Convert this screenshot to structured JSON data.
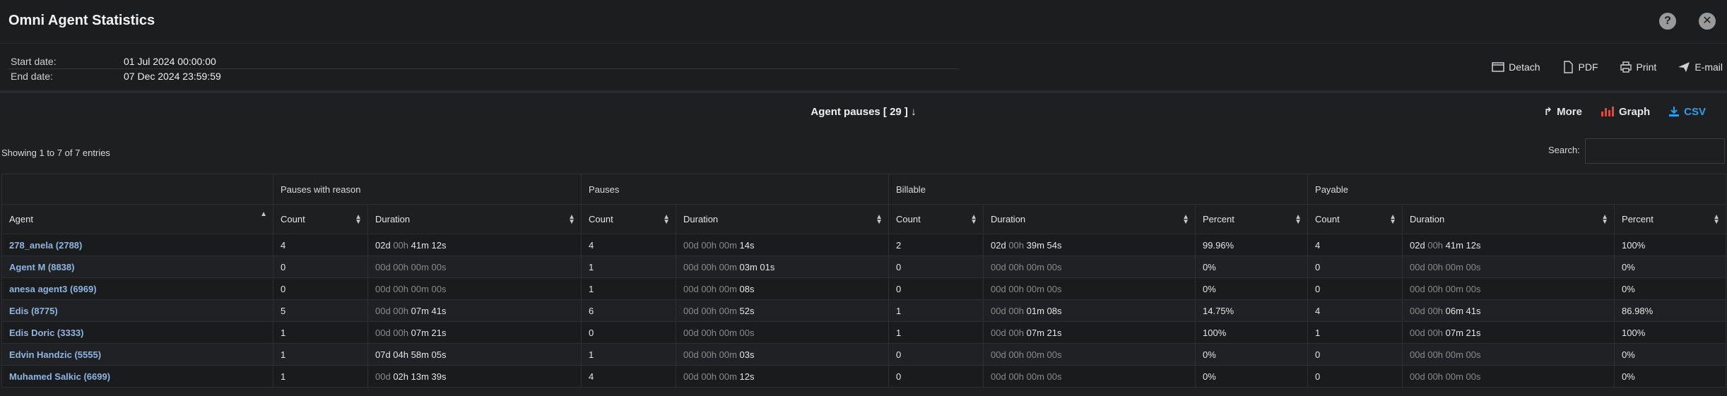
{
  "app": {
    "title": "Omni Agent Statistics",
    "help_icon": "help-icon",
    "close_icon": "close-icon"
  },
  "info": {
    "start_label": "Start date:",
    "start_value": "01 Jul 2024 00:00:00",
    "end_label": "End date:",
    "end_value": "07 Dec 2024 23:59:59"
  },
  "actions": {
    "detach": "Detach",
    "pdf": "PDF",
    "print": "Print",
    "email": "E-mail"
  },
  "report": {
    "title": "Agent pauses [ 29 ]",
    "more": "More",
    "graph": "Graph",
    "csv": "CSV",
    "colors": {
      "graph": "#e8443a",
      "csv": "#2f9de8"
    }
  },
  "table": {
    "showing": "Showing 1 to 7 of 7 entries",
    "search_label": "Search:",
    "search_value": "",
    "groups": [
      "Pauses with reason",
      "Pauses",
      "Billable",
      "Payable"
    ],
    "columns": [
      "Agent",
      "Count",
      "Duration",
      "Count",
      "Duration",
      "Count",
      "Duration",
      "Percent",
      "Count",
      "Duration",
      "Percent"
    ],
    "rows": [
      {
        "agent": "278_anela (2788)",
        "c1": "4",
        "d1": [
          "02d",
          "00h",
          "41m 12s"
        ],
        "c2": "4",
        "d2": [
          "00d 00h 00m",
          "14s"
        ],
        "c3": "2",
        "d3": [
          "02d",
          "00h",
          "39m 54s"
        ],
        "p3": "99.96%",
        "c4": "4",
        "d4": [
          "02d",
          "00h",
          "41m 12s"
        ],
        "p4": "100%"
      },
      {
        "agent": "Agent M (8838)",
        "c1": "0",
        "d1": [
          "00d 00h 00m 00s",
          "",
          ""
        ],
        "c2": "1",
        "d2": [
          "00d 00h 00m",
          "03m 01s"
        ],
        "c3": "0",
        "d3": [
          "00d 00h 00m 00s",
          "",
          ""
        ],
        "p3": "0%",
        "c4": "0",
        "d4": [
          "00d 00h 00m 00s",
          "",
          ""
        ],
        "p4": "0%"
      },
      {
        "agent": "anesa agent3 (6969)",
        "c1": "0",
        "d1": [
          "00d 00h 00m 00s",
          "",
          ""
        ],
        "c2": "1",
        "d2": [
          "00d 00h 00m",
          "08s"
        ],
        "c3": "0",
        "d3": [
          "00d 00h 00m 00s",
          "",
          ""
        ],
        "p3": "0%",
        "c4": "0",
        "d4": [
          "00d 00h 00m 00s",
          "",
          ""
        ],
        "p4": "0%"
      },
      {
        "agent": "Edis (8775)",
        "c1": "5",
        "d1": [
          "00d 00h",
          "",
          "07m 41s"
        ],
        "c2": "6",
        "d2": [
          "00d 00h 00m",
          "52s"
        ],
        "c3": "1",
        "d3": [
          "00d 00h",
          "",
          "01m 08s"
        ],
        "p3": "14.75%",
        "c4": "4",
        "d4": [
          "00d 00h",
          "",
          "06m 41s"
        ],
        "p4": "86.98%"
      },
      {
        "agent": "Edis Doric (3333)",
        "c1": "1",
        "d1": [
          "00d 00h",
          "",
          "07m 21s"
        ],
        "c2": "0",
        "d2": [
          "00d 00h 00m 00s",
          ""
        ],
        "c3": "1",
        "d3": [
          "00d 00h",
          "",
          "07m 21s"
        ],
        "p3": "100%",
        "c4": "1",
        "d4": [
          "00d 00h",
          "",
          "07m 21s"
        ],
        "p4": "100%"
      },
      {
        "agent": "Edvin Handzic (5555)",
        "c1": "1",
        "d1": [
          "",
          "",
          "07d 04h 58m 05s"
        ],
        "c2": "1",
        "d2": [
          "00d 00h 00m",
          "03s"
        ],
        "c3": "0",
        "d3": [
          "00d 00h 00m 00s",
          "",
          ""
        ],
        "p3": "0%",
        "c4": "0",
        "d4": [
          "00d 00h 00m 00s",
          "",
          ""
        ],
        "p4": "0%"
      },
      {
        "agent": "Muhamed Salkic (6699)",
        "c1": "1",
        "d1": [
          "00d",
          "",
          "02h 13m 39s"
        ],
        "c2": "4",
        "d2": [
          "00d 00h 00m",
          "12s"
        ],
        "c3": "0",
        "d3": [
          "00d 00h 00m 00s",
          "",
          ""
        ],
        "p3": "0%",
        "c4": "0",
        "d4": [
          "00d 00h 00m 00s",
          "",
          ""
        ],
        "p4": "0%"
      }
    ]
  }
}
